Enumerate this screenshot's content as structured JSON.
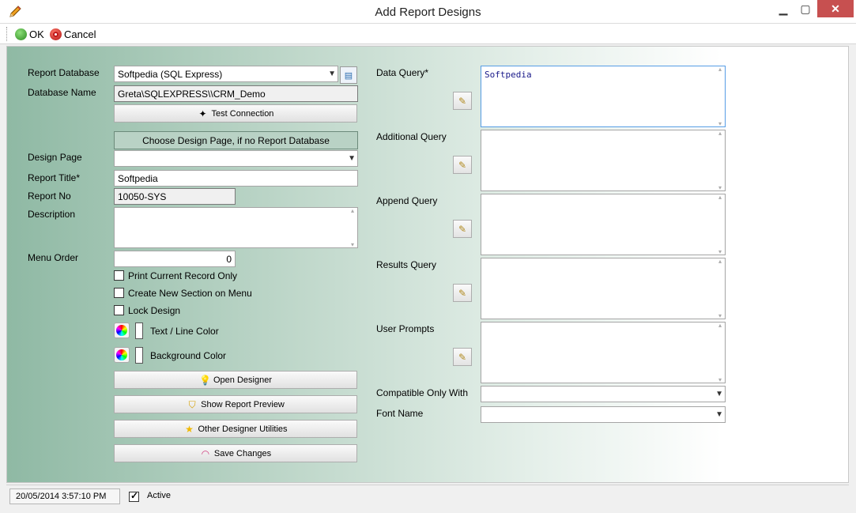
{
  "window": {
    "title": "Add Report Designs",
    "app_icon": "pencil-icon",
    "close_color": "#c75050"
  },
  "toolbar": {
    "ok_label": "OK",
    "cancel_label": "Cancel"
  },
  "left": {
    "report_database_label": "Report Database",
    "report_database_value": "Softpedia (SQL Express)",
    "database_name_label": "Database Name",
    "database_name_value": "Greta\\SQLEXPRESS\\\\CRM_Demo",
    "test_connection_label": "Test Connection",
    "choose_design_label": "Choose Design Page, if no Report Database",
    "design_page_label": "Design Page",
    "design_page_value": "",
    "report_title_label": "Report Title*",
    "report_title_value": "Softpedia",
    "report_no_label": "Report No",
    "report_no_value": "10050-SYS",
    "description_label": "Description",
    "description_value": "",
    "menu_order_label": "Menu Order",
    "menu_order_value": "0",
    "print_current_label": "Print Current Record Only",
    "print_current_checked": false,
    "create_section_label": "Create New Section on Menu",
    "create_section_checked": false,
    "lock_design_label": "Lock Design",
    "lock_design_checked": false,
    "text_line_color_label": "Text / Line Color",
    "background_color_label": "Background Color",
    "open_designer_label": "Open Designer",
    "show_preview_label": "Show Report Preview",
    "other_utilities_label": "Other Designer Utilities",
    "save_changes_label": "Save Changes"
  },
  "right": {
    "data_query_label": "Data Query*",
    "data_query_value": "Softpedia",
    "additional_query_label": "Additional Query",
    "append_query_label": "Append Query",
    "results_query_label": "Results Query",
    "user_prompts_label": "User Prompts",
    "compatible_label": "Compatible Only With",
    "compatible_value": "",
    "font_name_label": "Font Name",
    "font_name_value": ""
  },
  "status": {
    "datetime": "20/05/2014 3:57:10 PM",
    "active_label": "Active",
    "active_checked": true
  },
  "colors": {
    "panel_left": "#8fb9a4",
    "panel_right": "#ffffff",
    "choose_button": "#b9d2c5",
    "query_focus": "#569de5"
  }
}
